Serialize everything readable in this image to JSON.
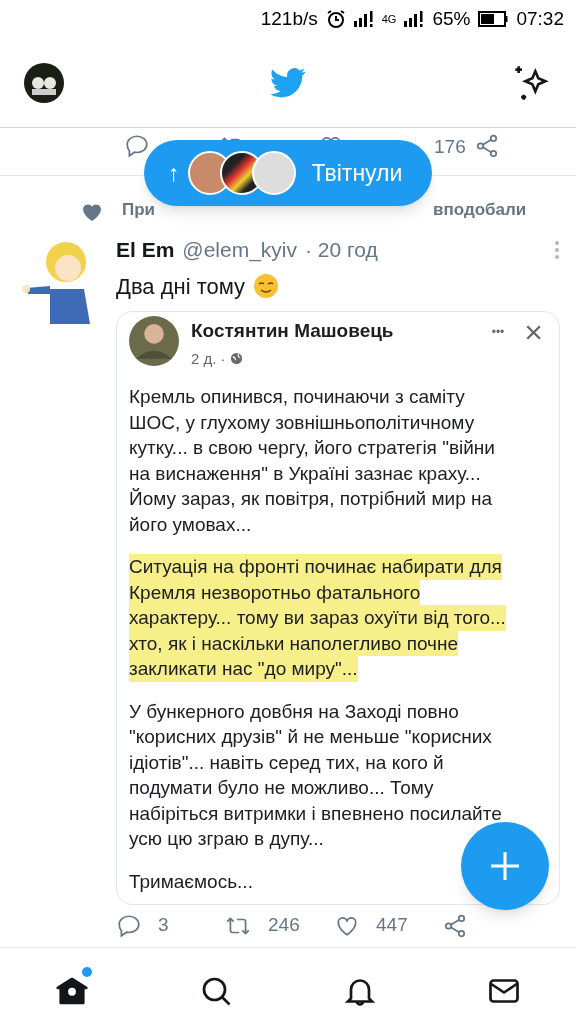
{
  "status_bar": {
    "speed": "121b/s",
    "network": "4G",
    "battery": "65%",
    "time": "07:32"
  },
  "previous_tweet": {
    "like_count": "176"
  },
  "new_tweets_pill": {
    "arrow": "↑",
    "label": "Твітнули"
  },
  "liked_by": {
    "text_start": "При",
    "text_end": "вподобали"
  },
  "tweet": {
    "name": "El Em",
    "handle": "@elem_kyiv",
    "time": "· 20 год",
    "text": "Два дні тому",
    "embed": {
      "author": "Костянтин Машовець",
      "date": "2 д. ·",
      "more": "•••",
      "close": "×",
      "paragraphs": [
        {
          "lines": [
            "Кремль опинився, починаючи з саміту",
            "ШОС, у глухому зовнішньополітичному",
            "кутку... в свою чергу, його стратегія \"війни",
            "на виснаження\" в Україні зазнає краху...",
            "Йому зараз, як повітря, потрібний мир на",
            "його умовах..."
          ],
          "highlighted": false
        },
        {
          "lines": [
            "Ситуація на фронті починає набирати для",
            "Кремля незворотньо фатального",
            "характеру... тому ви зараз охуїти від того...",
            "хто, як і наскільки наполегливо почне",
            "закликати нас \"до миру\"..."
          ],
          "highlighted": true
        },
        {
          "lines": [
            "У бункерного довбня на Заході повно",
            "\"корисних друзів\" й не меньше \"корисних",
            "ідіотів\"... навіть серед тих, на кого й",
            "подумати було не можливо... Тому",
            "набіріться витримки і впевнено посилайте",
            "усю цю зграю в дупу..."
          ],
          "highlighted": false
        },
        {
          "lines": [
            "Тримаємось..."
          ],
          "highlighted": false
        }
      ]
    },
    "replies": "3",
    "retweets": "246",
    "likes": "447"
  },
  "bottom_nav": [
    {
      "kind": "home",
      "selected": true,
      "badge": true
    },
    {
      "kind": "search",
      "selected": false,
      "badge": false
    },
    {
      "kind": "notifications",
      "selected": false,
      "badge": false
    },
    {
      "kind": "messages",
      "selected": false,
      "badge": false
    }
  ]
}
